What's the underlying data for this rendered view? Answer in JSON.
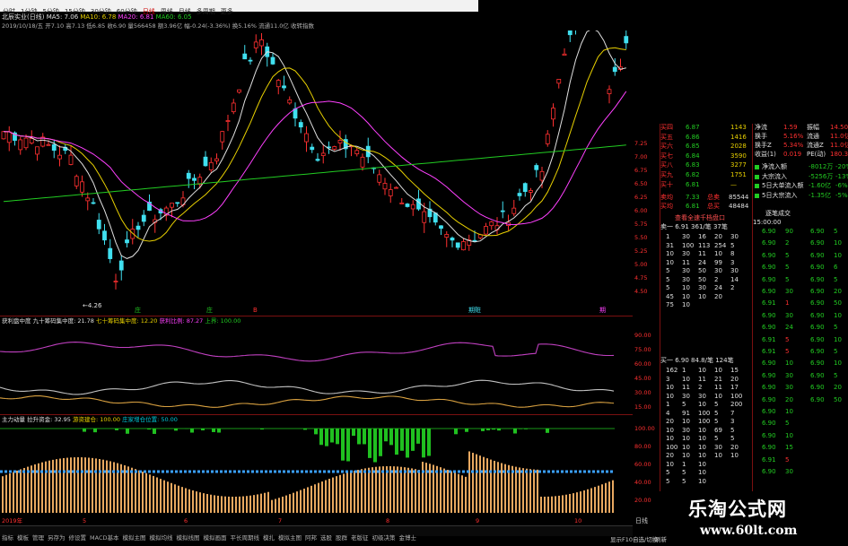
{
  "toolbar": {
    "tabs": [
      "分时",
      "1分钟",
      "5分钟",
      "15分钟",
      "30分钟",
      "60分钟",
      "日线",
      "周线",
      "月线",
      "多周期",
      "更多"
    ],
    "active_index": 6
  },
  "main_chart": {
    "title": "北辰实业(日线)",
    "ma_labels": [
      {
        "text": "MA5: 7.06",
        "color": "#e0e0e0"
      },
      {
        "text": "MA10: 6.78",
        "color": "#e8d000"
      },
      {
        "text": "MA20: 6.81",
        "color": "#ff40ff"
      },
      {
        "text": "MA60: 6.05",
        "color": "#22cc22"
      }
    ],
    "info_line": "2019/10/18/五  开7.10  高7.13  低6.85  收6.90  量566458  额3.96亿  幅-0.24(-3.36%)  换5.16%  流通11.0亿  收转指数",
    "low_label": "4.26",
    "price_axis": [
      "7.25",
      "7.00",
      "6.75",
      "6.50",
      "6.25",
      "6.00",
      "5.75",
      "5.50",
      "5.25",
      "5.00",
      "4.75",
      "4.50"
    ]
  },
  "ind1": {
    "legend": [
      {
        "text": "获利盘中度 九十筹码集中度: 21.78",
        "color": "#e0e0e0"
      },
      {
        "text": "七十筹码集中度: 12.20",
        "color": "#e8d000"
      },
      {
        "text": "获利比例: 87.27",
        "color": "#ff40ff"
      },
      {
        "text": "上界: 100.00",
        "color": "#22cc22"
      }
    ],
    "axis": [
      "90.00",
      "75.00",
      "60.00",
      "45.00",
      "30.00",
      "15.00"
    ]
  },
  "ind2": {
    "legend": [
      {
        "text": "主力动量 拉升资金: 32.95",
        "color": "#e0e0e0"
      },
      {
        "text": "游资建仓: 100.00",
        "color": "#e8d000"
      },
      {
        "text": "庄家增仓位置: 50.00",
        "color": "#00c8d8"
      }
    ],
    "axis": [
      "100.00",
      "80.00",
      "60.00",
      "40.00",
      "20.00"
    ]
  },
  "date_axis": {
    "labels": [
      "2019年",
      "5",
      "6",
      "7",
      "8",
      "9",
      "10"
    ],
    "period": "日线"
  },
  "markers": {
    "marks": [
      "庄",
      "庄",
      "B",
      "期赃",
      "期"
    ]
  },
  "order_book": {
    "buy_rows": [
      {
        "label": "买四",
        "price": "6.87",
        "vol": "1143"
      },
      {
        "label": "买五",
        "price": "6.86",
        "vol": "1416"
      },
      {
        "label": "买六",
        "price": "6.85",
        "vol": "2028"
      },
      {
        "label": "买七",
        "price": "6.84",
        "vol": "3590"
      },
      {
        "label": "买八",
        "price": "6.83",
        "vol": "3277"
      },
      {
        "label": "买九",
        "price": "6.82",
        "vol": "1751"
      },
      {
        "label": "买十",
        "price": "6.81",
        "vol": "—"
      }
    ],
    "total_rows": [
      {
        "label": "卖均",
        "price": "7.33",
        "tlabel": "总卖",
        "tval": "85544"
      },
      {
        "label": "买均",
        "price": "6.81",
        "tlabel": "总买",
        "tval": "48484"
      }
    ],
    "queue_header": "查看全速千档盘口",
    "queue_label": "卖一  6.91  361/笔  37笔",
    "queue_values": [
      "1",
      "31",
      "10",
      "10",
      "5",
      "5",
      "5",
      "45",
      "75"
    ],
    "queue_values2": [
      "30",
      "100",
      "30",
      "11",
      "30",
      "30",
      "10",
      "10",
      "10"
    ],
    "queue_values3": [
      "16",
      "113",
      "11",
      "24",
      "50",
      "50",
      "30",
      "10",
      ""
    ],
    "queue_values4": [
      "20",
      "254",
      "10",
      "99",
      "30",
      "2",
      "24",
      "20",
      ""
    ],
    "queue_values5": [
      "30",
      "5",
      "8",
      "3",
      "30",
      "14",
      "2",
      "",
      ""
    ],
    "buy_queue_label": "买一  6.90  84.8/笔  124笔",
    "buy_q1": [
      "162",
      "3",
      "10",
      "10",
      "1",
      "4",
      "20",
      "10",
      "10",
      "100",
      "20",
      "10",
      "5",
      "5"
    ],
    "buy_q2": [
      "1",
      "10",
      "11",
      "30",
      "5",
      "91",
      "10",
      "30",
      "10",
      "10",
      "10",
      "1",
      "5",
      "5"
    ],
    "buy_q3": [
      "10",
      "11",
      "2",
      "30",
      "10",
      "100",
      "100",
      "10",
      "10",
      "10",
      "10",
      "10",
      "10",
      "10"
    ],
    "buy_q4": [
      "10",
      "21",
      "11",
      "10",
      "5",
      "5",
      "5",
      "69",
      "5",
      "30",
      "10",
      "",
      ""
    ],
    "buy_q5": [
      "15",
      "20",
      "17",
      "100",
      "200",
      "7",
      "3",
      "5",
      "5",
      "20",
      "10",
      "",
      ""
    ]
  },
  "quote_panel": {
    "rows": [
      {
        "l": "净流",
        "v": "1.59",
        "l2": "振幅",
        "v2": "14.50"
      },
      {
        "l": "换手",
        "v": "5.16%",
        "l2": "流通",
        "v2": "11.0亿"
      },
      {
        "l": "换手Z",
        "v": "5.34%",
        "l2": "流通Z",
        "v2": "11.0亿"
      },
      {
        "l": "收益(1)",
        "v": "0.019",
        "l2": "PE(动)",
        "v2": "180.3"
      }
    ],
    "flow_rows": [
      {
        "l": "净流入额",
        "v": "-8012万",
        "p": "-20%"
      },
      {
        "l": "大宗流入",
        "v": "-5256万",
        "p": "-13%"
      },
      {
        "l": "5日大单流入额",
        "v": "-1.60亿",
        "p": "-6%"
      },
      {
        "l": "5日大宗流入",
        "v": "-1.35亿",
        "p": "-5%"
      }
    ],
    "tick_header": "逐笔成交",
    "tick_time": "15:00:00",
    "ticks": [
      {
        "p": "6.90",
        "v": "90",
        "c": "green"
      },
      {
        "p": "6.90",
        "v": "2",
        "c": "green"
      },
      {
        "p": "6.90",
        "v": "5",
        "c": "green"
      },
      {
        "p": "6.90",
        "v": "5",
        "c": "green"
      },
      {
        "p": "6.90",
        "v": "5",
        "c": "green"
      },
      {
        "p": "6.90",
        "v": "30",
        "c": "green"
      },
      {
        "p": "6.91",
        "v": "1",
        "c": "red"
      },
      {
        "p": "6.90",
        "v": "30",
        "c": "green"
      },
      {
        "p": "6.90",
        "v": "24",
        "c": "green"
      },
      {
        "p": "6.91",
        "v": "5",
        "c": "red"
      },
      {
        "p": "6.91",
        "v": "5",
        "c": "red"
      },
      {
        "p": "6.90",
        "v": "10",
        "c": "green"
      },
      {
        "p": "6.90",
        "v": "30",
        "c": "green"
      },
      {
        "p": "6.90",
        "v": "30",
        "c": "green"
      },
      {
        "p": "6.90",
        "v": "20",
        "c": "green"
      },
      {
        "p": "6.90",
        "v": "10",
        "c": "green"
      },
      {
        "p": "6.90",
        "v": "5",
        "c": "green"
      },
      {
        "p": "6.90",
        "v": "10",
        "c": "green"
      },
      {
        "p": "6.90",
        "v": "15",
        "c": "green"
      },
      {
        "p": "6.91",
        "v": "5",
        "c": "red"
      },
      {
        "p": "6.90",
        "v": "30",
        "c": "green"
      },
      {
        "p": "6.90",
        "v": "5",
        "c": "green"
      },
      {
        "p": "6.90",
        "v": "10",
        "c": "green"
      },
      {
        "p": "6.90",
        "v": "10",
        "c": "green"
      },
      {
        "p": "6.90",
        "v": "6",
        "c": "green"
      },
      {
        "p": "6.90",
        "v": "5",
        "c": "green"
      },
      {
        "p": "6.90",
        "v": "20",
        "c": "green"
      },
      {
        "p": "6.90",
        "v": "50",
        "c": "green"
      },
      {
        "p": "6.90",
        "v": "10",
        "c": "green"
      },
      {
        "p": "6.90",
        "v": "5",
        "c": "green"
      },
      {
        "p": "6.90",
        "v": "10",
        "c": "green"
      },
      {
        "p": "6.90",
        "v": "5",
        "c": "green"
      },
      {
        "p": "6.90",
        "v": "10",
        "c": "green"
      },
      {
        "p": "6.90",
        "v": "5",
        "c": "green"
      },
      {
        "p": "6.90",
        "v": "20",
        "c": "green"
      },
      {
        "p": "6.90",
        "v": "50",
        "c": "green"
      }
    ]
  },
  "bottom_menu": {
    "items": [
      "指标",
      "模板",
      "管理",
      "另存为",
      "修设置",
      "MACD基本",
      "模拟主图",
      "模拟均线",
      "模拟线图",
      "模拟画面",
      "平长周期线",
      "模扎",
      "模拟主图",
      "阿邦",
      "选股",
      "股群",
      "老版征",
      "初级决策",
      "金博士"
    ],
    "right": [
      "显示F10",
      "自选/切换",
      "刷新"
    ]
  },
  "watermark": {
    "name": "乐淘公式网",
    "url": "www.60lt.com"
  }
}
